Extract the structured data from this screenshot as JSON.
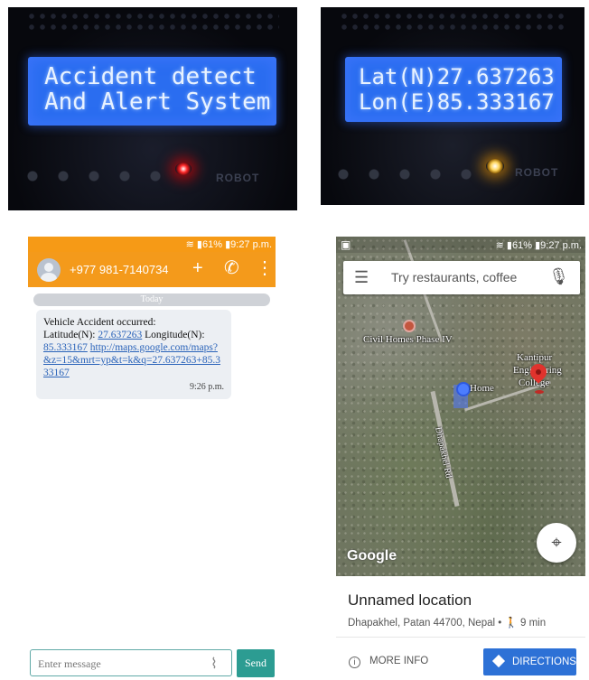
{
  "lcd1": {
    "line1": "Accident detect",
    "line2": "And Alert System",
    "board_text": "ROBOT"
  },
  "lcd2": {
    "line1": "Lat(N)27.637263",
    "line2": "Lon(E)85.333167",
    "board_text": "ROBOT"
  },
  "sms": {
    "status": {
      "signal": "61%",
      "time": "9:27 p.m."
    },
    "contact": "+977 981-7140734",
    "day_label": "Today",
    "message": {
      "line1": "Vehicle Accident occurred:",
      "lat_label": "Latitude(N):",
      "lat_value": "27.637263",
      "lon_label": "Longitude(N):",
      "lon_value": "85.333167",
      "link": "http://maps.google.com/maps?&z=15&mrt=yp&t=k&q=27.637263+85.333167",
      "time": "9:26 p.m."
    },
    "input_placeholder": "Enter message",
    "send_label": "Send"
  },
  "map": {
    "status": {
      "signal": "61%",
      "time": "9:27 p.m."
    },
    "search_placeholder": "Try restaurants, coffee",
    "labels": {
      "civil_homes": "Civil Homes Phase IV",
      "home": "Home",
      "kantipur": "Kantipur",
      "engineering": "Engineering",
      "college": "College",
      "road": "Dhapakhel Rd"
    },
    "google": "Google",
    "place_title": "Unnamed location",
    "place_address": "Dhapakhel, Patan 44700, Nepal",
    "walk_time": "9 min",
    "more_info_label": "MORE INFO",
    "directions_label": "DIRECTIONS"
  }
}
